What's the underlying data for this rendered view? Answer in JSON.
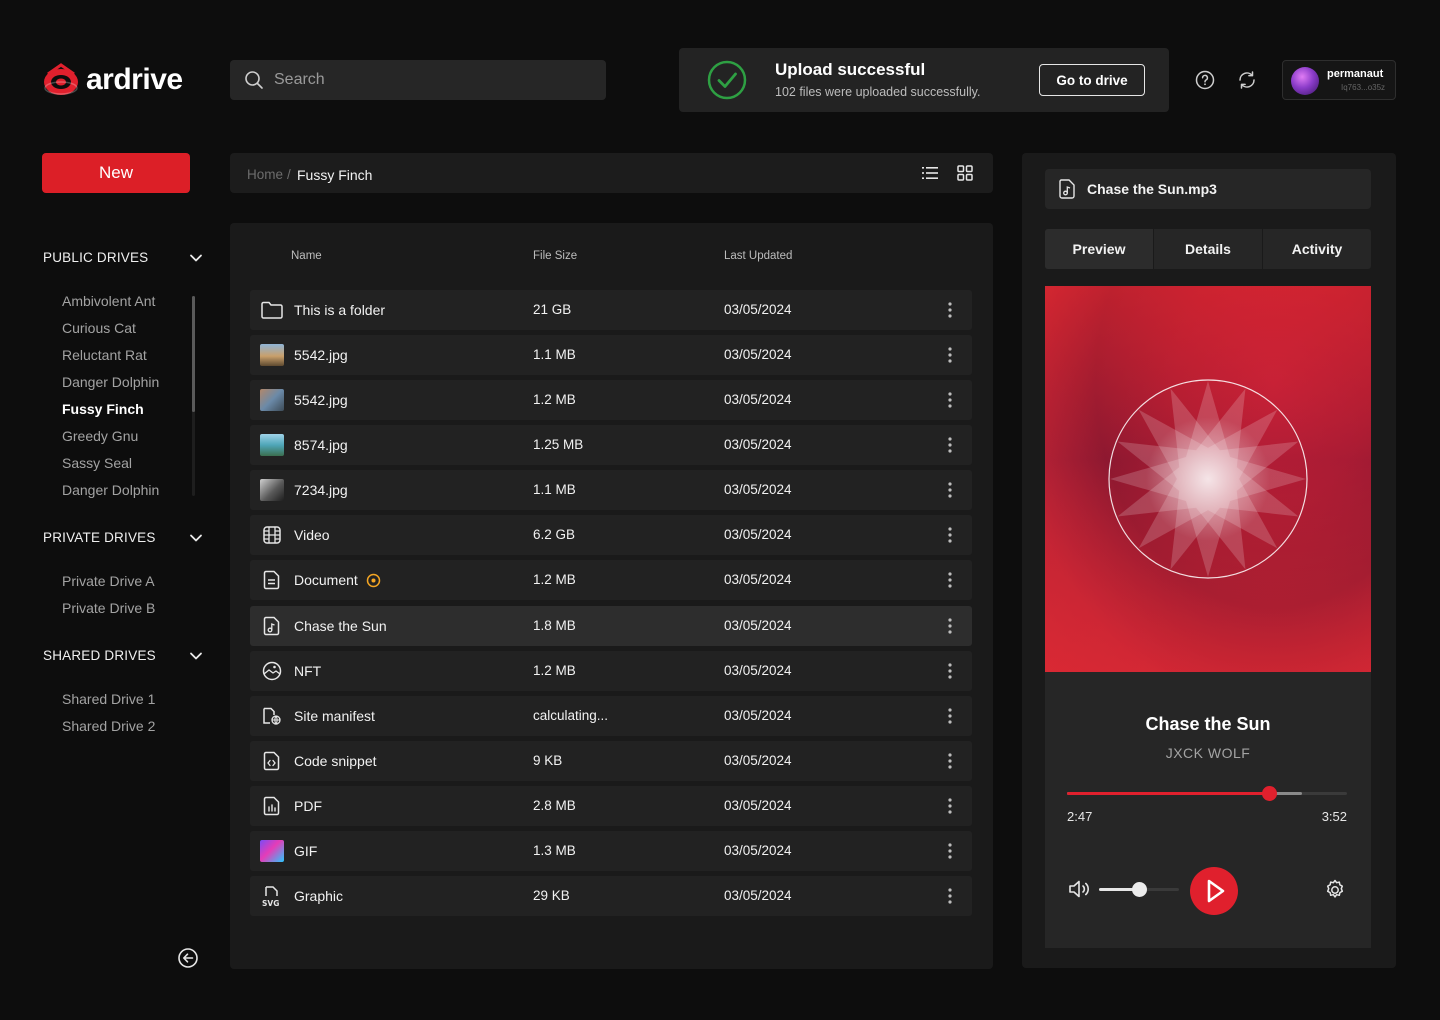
{
  "app": {
    "name": "ardrive"
  },
  "search": {
    "placeholder": "Search"
  },
  "toast": {
    "title": "Upload successful",
    "message": "102 files were uploaded successfully.",
    "action": "Go to drive"
  },
  "user": {
    "name": "permanaut",
    "address": "Iq763...o35z"
  },
  "sidebar": {
    "new_label": "New",
    "public": {
      "title": "PUBLIC DRIVES",
      "items": [
        "Ambivolent Ant",
        "Curious Cat",
        "Reluctant Rat",
        "Danger Dolphin",
        "Fussy Finch",
        "Greedy Gnu",
        "Sassy Seal",
        "Danger Dolphin"
      ],
      "active_index": 4
    },
    "private": {
      "title": "PRIVATE DRIVES",
      "items": [
        "Private Drive A",
        "Private Drive B"
      ]
    },
    "shared": {
      "title": "SHARED DRIVES",
      "items": [
        "Shared Drive 1",
        "Shared Drive 2"
      ]
    }
  },
  "breadcrumb": {
    "home": "Home",
    "separator": "/",
    "current": "Fussy Finch"
  },
  "table": {
    "columns": {
      "name": "Name",
      "size": "File Size",
      "updated": "Last Updated"
    },
    "rows": [
      {
        "name": "This is a folder",
        "size": "21 GB",
        "date": "03/05/2024",
        "icon": "folder-icon"
      },
      {
        "name": "5542.jpg",
        "size": "1.1 MB",
        "date": "03/05/2024",
        "icon": "image-thumbnail"
      },
      {
        "name": "5542.jpg",
        "size": "1.2 MB",
        "date": "03/05/2024",
        "icon": "image-thumbnail"
      },
      {
        "name": "8574.jpg",
        "size": "1.25 MB",
        "date": "03/05/2024",
        "icon": "image-thumbnail"
      },
      {
        "name": "7234.jpg",
        "size": "1.1 MB",
        "date": "03/05/2024",
        "icon": "image-thumbnail"
      },
      {
        "name": "Video",
        "size": "6.2 GB",
        "date": "03/05/2024",
        "icon": "video-icon"
      },
      {
        "name": "Document",
        "size": "1.2 MB",
        "date": "03/05/2024",
        "icon": "document-icon",
        "pending": true
      },
      {
        "name": "Chase the Sun",
        "size": "1.8 MB",
        "date": "03/05/2024",
        "icon": "music-file-icon",
        "selected": true
      },
      {
        "name": "NFT",
        "size": "1.2 MB",
        "date": "03/05/2024",
        "icon": "nft-icon"
      },
      {
        "name": "Site manifest",
        "size": "calculating...",
        "date": "03/05/2024",
        "icon": "manifest-icon"
      },
      {
        "name": "Code snippet",
        "size": "9 KB",
        "date": "03/05/2024",
        "icon": "code-file-icon"
      },
      {
        "name": "PDF",
        "size": "2.8 MB",
        "date": "03/05/2024",
        "icon": "pdf-icon"
      },
      {
        "name": "GIF",
        "size": "1.3 MB",
        "date": "03/05/2024",
        "icon": "gif-thumbnail"
      },
      {
        "name": "Graphic",
        "size": "29 KB",
        "date": "03/05/2024",
        "icon": "svg-icon"
      }
    ]
  },
  "preview": {
    "file_name": "Chase the Sun.mp3",
    "tabs": [
      "Preview",
      "Details",
      "Activity"
    ],
    "active_tab": 0,
    "track": {
      "title": "Chase the Sun",
      "artist": "JXCK WOLF"
    },
    "time_current": "2:47",
    "time_total": "3:52",
    "progress": 0.72,
    "buffered": 0.84,
    "volume": 0.5
  },
  "colors": {
    "accent": "#dc1f27",
    "success": "#2ea043",
    "pending": "#f5a623"
  }
}
